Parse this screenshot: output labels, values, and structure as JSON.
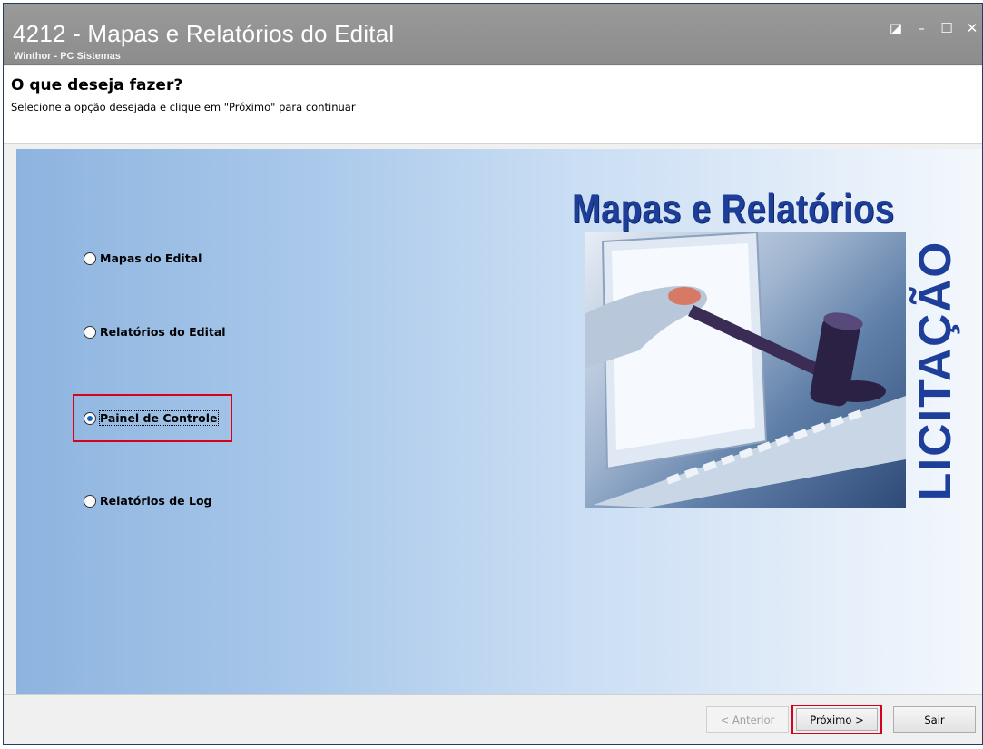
{
  "window": {
    "title": "4212 - Mapas e Relatórios do Edital",
    "subtitle": "Winthor - PC Sistemas",
    "controls": {
      "restore": "◪",
      "minimize": "–",
      "maximize": "☐",
      "close": "✕"
    }
  },
  "header": {
    "heading": "O que deseja fazer?",
    "instructions": "Selecione a opção desejada e clique em \"Próximo\" para continuar"
  },
  "options": [
    {
      "label": "Mapas do Edital",
      "checked": false
    },
    {
      "label": "Relatórios do Edital",
      "checked": false
    },
    {
      "label": "Painel de Controle",
      "checked": true
    },
    {
      "label": "Relatórios de Log",
      "checked": false
    }
  ],
  "promo": {
    "title": "Mapas e Relatórios",
    "side_text": "LICITAÇÃO"
  },
  "footer": {
    "back_label": "< Anterior",
    "next_label": "Próximo >",
    "exit_label": "Sair"
  },
  "colors": {
    "highlight": "#d9001b",
    "accent": "#1565c0",
    "promo_text": "#1e3f99"
  }
}
